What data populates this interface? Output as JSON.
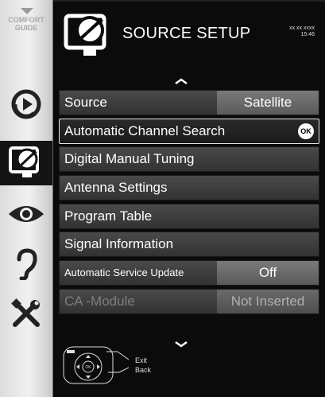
{
  "sidebar": {
    "title": "COMFORT\nGUIDE",
    "items": [
      {
        "icon": "source-play-icon",
        "active": false
      },
      {
        "icon": "satellite-dish-icon",
        "active": true
      },
      {
        "icon": "eye-icon",
        "active": false
      },
      {
        "icon": "ear-icon",
        "active": false
      },
      {
        "icon": "tools-icon",
        "active": false
      }
    ]
  },
  "header": {
    "title": "SOURCE SETUP",
    "date": "xx.xx.xxxx",
    "time": "15:46",
    "icon": "satellite-dish-icon"
  },
  "menu": {
    "items": [
      {
        "label": "Source",
        "value": "Satellite"
      },
      {
        "label": "Automatic Channel Search",
        "badge": "OK"
      },
      {
        "label": "Digital Manual Tuning"
      },
      {
        "label": "Antenna Settings"
      },
      {
        "label": "Program Table"
      },
      {
        "label": "Signal Information"
      },
      {
        "label": "Automatic Service Update",
        "value": "Off"
      },
      {
        "label": "CA -Module",
        "value": "Not Inserted"
      }
    ]
  },
  "footer": {
    "exit_label": "Exit",
    "back_label": "Back",
    "ok_label": "OK"
  }
}
